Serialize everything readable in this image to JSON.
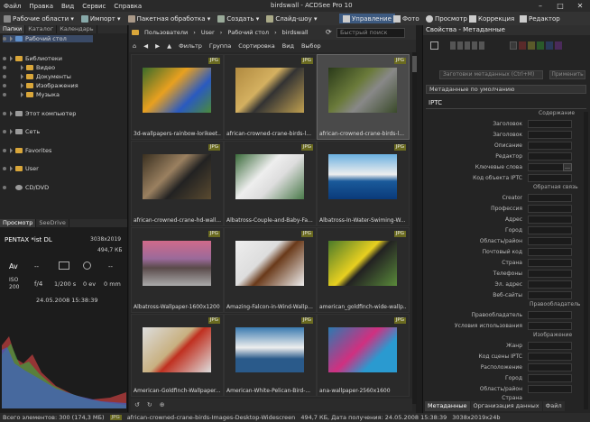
{
  "menu": [
    "Файл",
    "Правка",
    "Вид",
    "Сервис",
    "Справка"
  ],
  "window_title": "birdswall - ACDSee Pro 10",
  "toolbar": {
    "items": [
      "Рабочие области",
      "Импорт",
      "Пакетная обработка",
      "Создать",
      "Слайд-шоу"
    ],
    "modes": [
      "Управление",
      "Фото",
      "Просмотр",
      "Коррекция",
      "Редактор"
    ]
  },
  "left": {
    "tabs": [
      "Папки",
      "Каталог",
      "Календарь"
    ],
    "tree": [
      "Рабочий стол",
      "Библиотеки",
      "Видео",
      "Документы",
      "Изображения",
      "Музыка",
      "Этот компьютер",
      "Сеть",
      "Favorites",
      "User",
      "CD/DVD"
    ]
  },
  "preview": {
    "tabs": [
      "Просмотр",
      "SeeDrive"
    ],
    "camera": "PENTAX *ist DL",
    "dims": "3038x2019",
    "size": "494,7 КБ",
    "row1": [
      "Av",
      "--",
      "",
      "",
      ""
    ],
    "iso": "ISO 200",
    "aperture": "f/4",
    "shutter": "1/200 s",
    "ev": "0 ev",
    "focal": "0 mm",
    "date": "24.05.2008 15:38:39"
  },
  "center": {
    "path": [
      "Пользователи",
      "User",
      "Рабочий стол",
      "birdswall"
    ],
    "search_placeholder": "Быстрый поиск",
    "filters": [
      "Фильтр",
      "Группа",
      "Сортировка",
      "Вид",
      "Выбор"
    ],
    "thumbs": [
      {
        "cap": "3d-wallpapers-rainbow-lorikeet...",
        "tag": "JPG"
      },
      {
        "cap": "african-crowned-crane-birds-l...",
        "tag": "JPG"
      },
      {
        "cap": "african-crowned-crane-birds-l...",
        "tag": "JPG"
      },
      {
        "cap": "african-crowned-crane-hd-wall...",
        "tag": "JPG"
      },
      {
        "cap": "Albatross-Couple-and-Baby-Fa...",
        "tag": "JPG"
      },
      {
        "cap": "Albatross-In-Water-Swiming-W...",
        "tag": "JPG"
      },
      {
        "cap": "Albatross-Wallpaper-1600x1200",
        "tag": "JPG"
      },
      {
        "cap": "Amazing-Falcon-in-Wind-Wallp...",
        "tag": "JPG"
      },
      {
        "cap": "american_goldfinch-wide-wallp...",
        "tag": "JPG"
      },
      {
        "cap": "American-Goldfinch-Wallpaper...",
        "tag": "JPG"
      },
      {
        "cap": "American-White-Pelican-Bird-...",
        "tag": "JPG"
      },
      {
        "cap": "ana-wallpaper-2560x1600",
        "tag": "JPG"
      }
    ]
  },
  "right": {
    "title": "Свойства - Метаданные",
    "preset": "Заготовки метаданных (Ctrl+M)",
    "apply": "Применить",
    "defaults": "Метаданные по умолчанию",
    "iptc": "IPTC",
    "sections": {
      "content": "Содержание",
      "feedback": "Обратная связь",
      "rights": "Правообладатель",
      "image": "Изображение"
    },
    "fields1": [
      "Заголовок",
      "Заголовок",
      "Описание",
      "Редактор",
      "Ключевые слова",
      "Код объекта IPTC"
    ],
    "fields2": [
      "Creator",
      "Профессия",
      "Адрес",
      "Город",
      "Область/район",
      "Почтовый код",
      "Страна",
      "Телефоны",
      "Эл. адрес",
      "Веб-сайты"
    ],
    "fields3": [
      "Правообладатель",
      "Условия использования"
    ],
    "fields4": [
      "Жанр",
      "Код сцены IPTC",
      "Расположение",
      "Город",
      "Область/район",
      "Страна"
    ],
    "bottom_tabs": [
      "Метаданные",
      "Организация данных",
      "Файл"
    ]
  },
  "status": {
    "total": "Всего элементов: 300  (174,3 МБ)",
    "file": "african-crowned-crane-birds-Images-Desktop-Widescreen",
    "info": "494,7 КБ, Дата получения: 24.05.2008 15:38:39",
    "dims": "3038x2019x24b"
  }
}
